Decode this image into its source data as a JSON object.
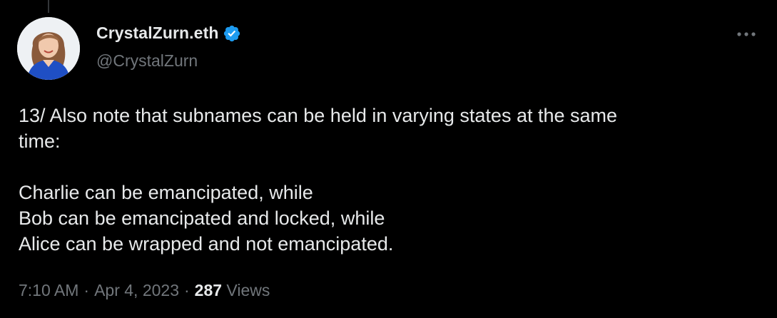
{
  "author": {
    "display_name": "CrystalZurn.eth",
    "handle": "@CrystalZurn",
    "verified": true
  },
  "tweet": {
    "lines": [
      "13/ Also note that subnames can be held in varying states at the same",
      "time:",
      "",
      "Charlie can be emancipated, while",
      "Bob can be emancipated and locked, while",
      "Alice can be wrapped and not emancipated."
    ]
  },
  "meta": {
    "time": "7:10 AM",
    "separator": "·",
    "date": "Apr 4, 2023",
    "views_count": "287",
    "views_label": "Views"
  },
  "icons": {
    "verified": "verified-badge-icon",
    "more": "more-horizontal-icon"
  },
  "colors": {
    "background": "#000000",
    "primary_text": "#e7e9ea",
    "secondary_text": "#71767b",
    "verified_blue": "#1d9bf0"
  }
}
